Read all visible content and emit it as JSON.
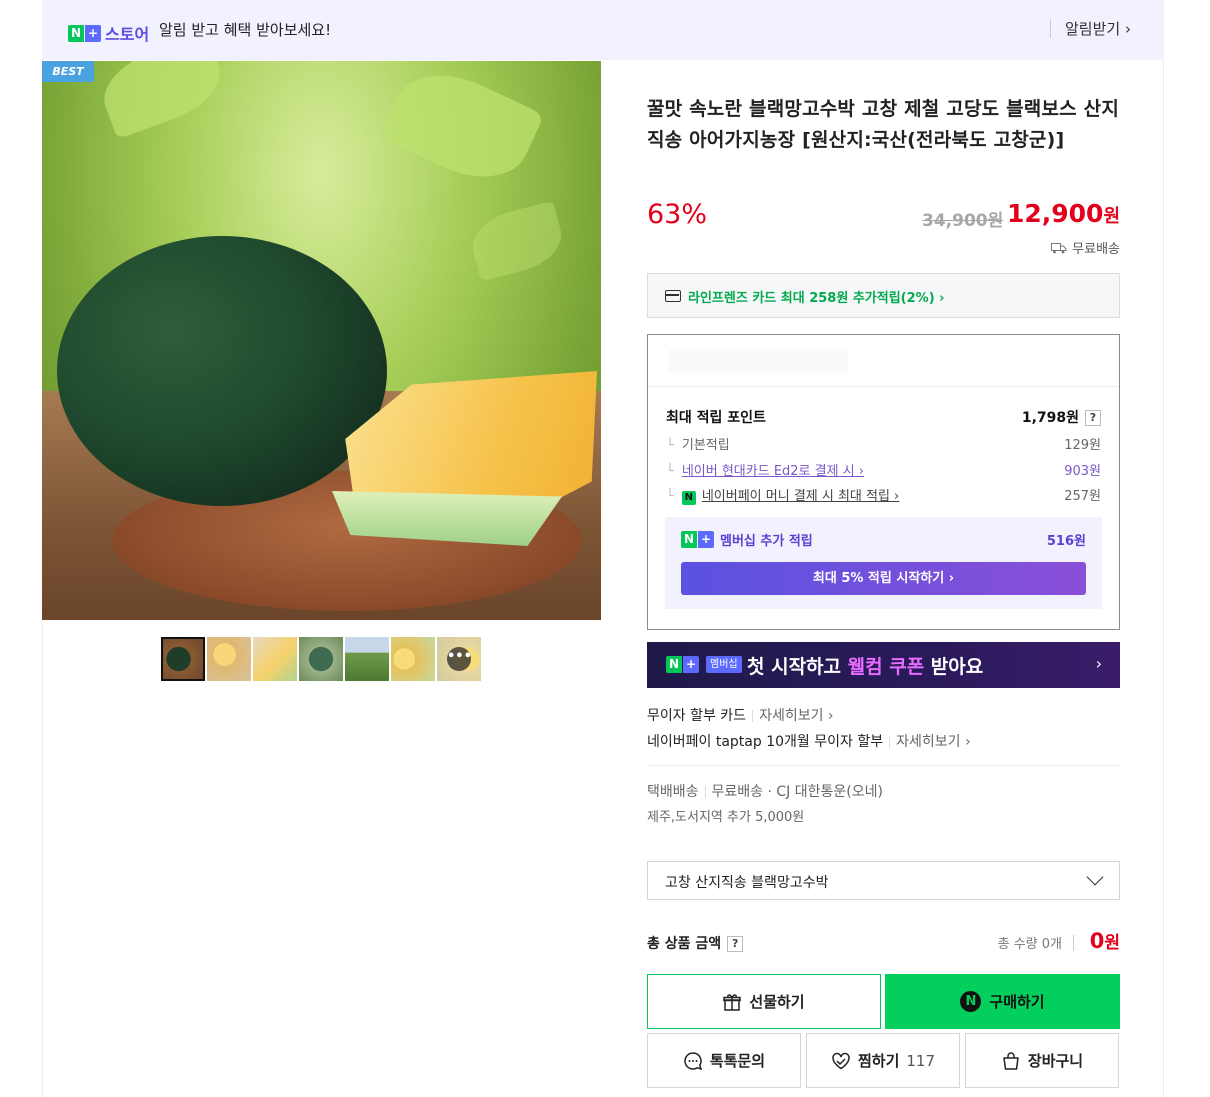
{
  "topbar": {
    "logo_n": "N",
    "logo_plus": "+",
    "logo_store": "스토어",
    "message": "알림 받고 혜택 받아보세요!",
    "notify_label": "알림받기 ›"
  },
  "gallery": {
    "badge": "BEST",
    "more_icon": "•••"
  },
  "product": {
    "title": "꿀맛 속노란 블랙망고수박 고창 제철 고당도 블랙보스 산지직송 아어가지농장 [원산지:국산(전라북도 고창군)]",
    "discount": "63%",
    "original_price": "34,900원",
    "price": "12,900",
    "price_unit": "원",
    "shipping": "무료배송"
  },
  "card_benefit": "라인프렌즈 카드 최대 258원 추가적립(2%) ›",
  "points": {
    "max_label": "최대 적립 포인트",
    "max_value": "1,798원",
    "help": "?",
    "rows": [
      {
        "label": "기본적립",
        "value": "129원"
      },
      {
        "label": "네이버 현대카드 Ed2로 결제 시 ›",
        "value": "903원"
      },
      {
        "label": "네이버페이 머니 결제 시 최대 적립 ›",
        "value": "257원"
      }
    ],
    "npay_icon": "N",
    "membership_label": "멤버십 추가 적립",
    "membership_value": "516원",
    "membership_button": "최대 5% 적립 시작하기 ›"
  },
  "banner": {
    "badge": "멤버십",
    "text_pre": "첫 시작하고 ",
    "text_em": "웰컴 쿠폰",
    "text_post": " 받아요",
    "arrow": "›"
  },
  "installment": {
    "line1_label": "무이자 할부 카드",
    "line1_link": "자세히보기 ›",
    "line2_label": "네이버페이 taptap 10개월 무이자 할부",
    "line2_link": "자세히보기 ›"
  },
  "delivery": {
    "method": "택배배송",
    "detail": "무료배송 · CJ 대한통운(오네)",
    "extra": "제주,도서지역 추가 5,000원"
  },
  "option_select": {
    "value": "고창 산지직송 블랙망고수박"
  },
  "total": {
    "label": "총 상품 금액",
    "help": "?",
    "quantity": "총 수량 0개",
    "amount": "0",
    "unit": "원"
  },
  "actions": {
    "gift": "선물하기",
    "buy": "구매하기",
    "talk": "톡톡문의",
    "wish": "찜하기",
    "wish_count": "117",
    "cart": "장바구니"
  }
}
